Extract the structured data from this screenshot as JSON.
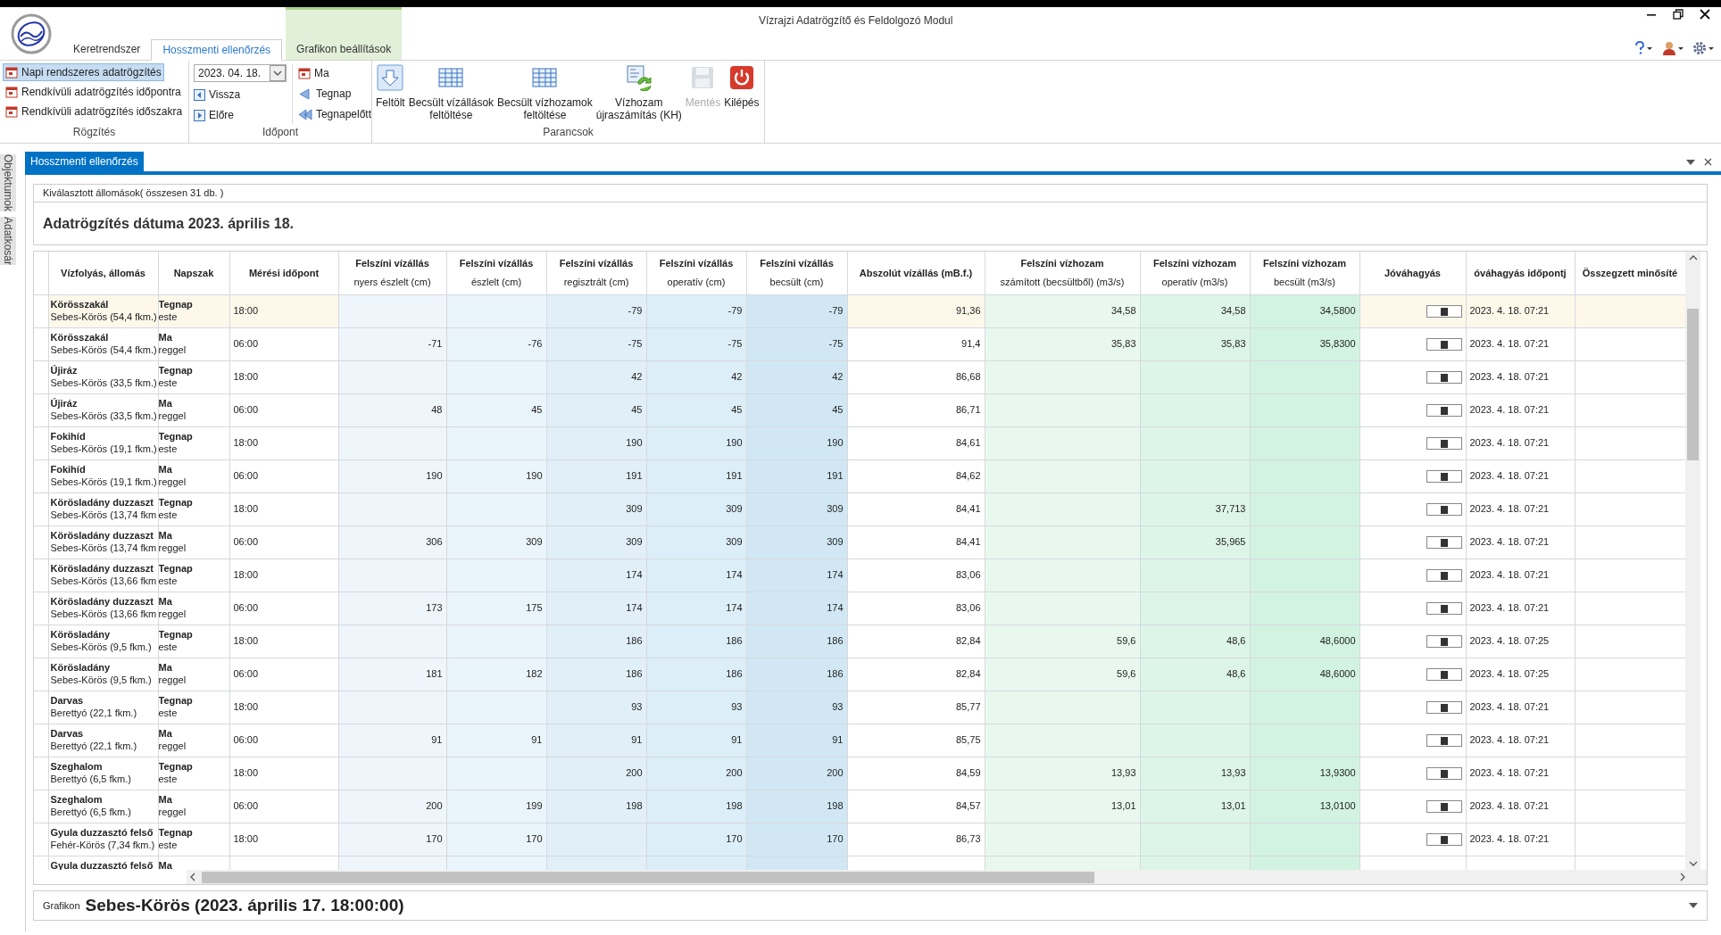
{
  "window": {
    "title": "Vízrajzi Adatrögzítő és Feldolgozó Modul"
  },
  "ribbon_tabs": [
    {
      "label": "Keretrendszer",
      "selected": false,
      "kind": "normal"
    },
    {
      "label": "Hosszmenti ellenőrzés",
      "selected": true,
      "kind": "normal"
    },
    {
      "label": "Grafikon beállítások",
      "selected": false,
      "kind": "contextual"
    }
  ],
  "groups": {
    "rogzites": {
      "caption": "Rögzítés",
      "items": [
        {
          "label": "Napi rendszeres adatrögzítés",
          "selected": true
        },
        {
          "label": "Rendkívüli adatrögzítés időpontra",
          "selected": false
        },
        {
          "label": "Rendkívüli adatrögzítés időszakra",
          "selected": false
        }
      ]
    },
    "idopont": {
      "caption": "Időpont",
      "date": "2023. 04. 18.",
      "steps": [
        "Vissza",
        "Előre"
      ],
      "days": [
        "Ma",
        "Tegnap",
        "Tegnapelőtt"
      ]
    },
    "parancsok": {
      "caption": "Parancsok",
      "buttons": [
        {
          "lines": [
            "Feltölt"
          ],
          "disabled": false
        },
        {
          "lines": [
            "Becsült vízállások",
            "feltöltése"
          ],
          "disabled": false
        },
        {
          "lines": [
            "Becsült vízhozamok",
            "feltöltése"
          ],
          "disabled": false
        },
        {
          "lines": [
            "Vízhozam",
            "újraszámítás (KH)"
          ],
          "disabled": false
        },
        {
          "lines": [
            "Mentés"
          ],
          "disabled": true
        },
        {
          "lines": [
            "Kilépés"
          ],
          "disabled": false
        }
      ]
    }
  },
  "side_tabs": [
    "Objektumok",
    "Adatkosár"
  ],
  "document_tab": {
    "label": "Hosszmenti ellenőrzés",
    "selected": true
  },
  "selection_info": "Kiválasztott állomások( összesen 31 db. )",
  "heading": "Adatrögzítés dátuma 2023. április 18.",
  "table": {
    "columns": [
      {
        "title": "Vízfolyás, állomás"
      },
      {
        "title": "Napszak"
      },
      {
        "title": "Mérési időpont"
      },
      {
        "title": "Felszíni vízállás",
        "subtitle": "nyers észlelt (cm)"
      },
      {
        "title": "Felszíni vízállás",
        "subtitle": "észlelt (cm)"
      },
      {
        "title": "Felszíni vízállás",
        "subtitle": "regisztrált (cm)"
      },
      {
        "title": "Felszíni vízállás",
        "subtitle": "operatív (cm)"
      },
      {
        "title": "Felszíni vízállás",
        "subtitle": "becsült (cm)"
      },
      {
        "title": "Abszolút vízállás (mB.f.)"
      },
      {
        "title": "Felszíni vízhozam",
        "subtitle": "számított (becsültből) (m3/s)"
      },
      {
        "title": "Felszíni vízhozam",
        "subtitle": "operatív (m3/s)"
      },
      {
        "title": "Felszíni vízhozam",
        "subtitle": "becsült (m3/s)"
      },
      {
        "title": "Jóváhagyás"
      },
      {
        "title": "óváhagyás időpontj"
      },
      {
        "title": "Összegzett minősíté"
      }
    ],
    "rows": [
      {
        "station": "Körösszakál",
        "river": "Sebes-Körös (54,4 fkm.)",
        "period": "Tegnap",
        "period_detail": "este",
        "time": "18:00",
        "values": {
          "regisztralt": "-79",
          "operativ": "-79",
          "becsult": "-79",
          "abszolut": "91,36",
          "q_szamitott": "34,58",
          "q_operativ": "34,58",
          "q_becsult": "34,5800"
        },
        "approved": true,
        "approval_time": "2023. 4. 18. 07:21",
        "selected": true
      },
      {
        "station": "Körösszakál",
        "river": "Sebes-Körös (54,4 fkm.)",
        "period": "Ma",
        "period_detail": "reggel",
        "time": "06:00",
        "values": {
          "nyers": "-71",
          "eszlelt": "-76",
          "regisztralt": "-75",
          "operativ": "-75",
          "becsult": "-75",
          "abszolut": "91,4",
          "q_szamitott": "35,83",
          "q_operativ": "35,83",
          "q_becsult": "35,8300"
        },
        "approved": true,
        "approval_time": "2023. 4. 18. 07:21",
        "selected": false
      },
      {
        "station": "Újiráz",
        "river": "Sebes-Körös (33,5 fkm.)",
        "period": "Tegnap",
        "period_detail": "este",
        "time": "18:00",
        "values": {
          "regisztralt": "42",
          "operativ": "42",
          "becsult": "42",
          "abszolut": "86,68"
        },
        "approved": true,
        "approval_time": "2023. 4. 18. 07:21",
        "selected": false
      },
      {
        "station": "Újiráz",
        "river": "Sebes-Körös (33,5 fkm.)",
        "period": "Ma",
        "period_detail": "reggel",
        "time": "06:00",
        "values": {
          "nyers": "48",
          "eszlelt": "45",
          "regisztralt": "45",
          "operativ": "45",
          "becsult": "45",
          "abszolut": "86,71"
        },
        "approved": true,
        "approval_time": "2023. 4. 18. 07:21",
        "selected": false
      },
      {
        "station": "Fokihíd",
        "river": "Sebes-Körös (19,1 fkm.)",
        "period": "Tegnap",
        "period_detail": "este",
        "time": "18:00",
        "values": {
          "regisztralt": "190",
          "operativ": "190",
          "becsult": "190",
          "abszolut": "84,61"
        },
        "approved": true,
        "approval_time": "2023. 4. 18. 07:21",
        "selected": false
      },
      {
        "station": "Fokihíd",
        "river": "Sebes-Körös (19,1 fkm.)",
        "period": "Ma",
        "period_detail": "reggel",
        "time": "06:00",
        "values": {
          "nyers": "190",
          "eszlelt": "190",
          "regisztralt": "191",
          "operativ": "191",
          "becsult": "191",
          "abszolut": "84,62"
        },
        "approved": true,
        "approval_time": "2023. 4. 18. 07:21",
        "selected": false
      },
      {
        "station": "Körösladány duzzaszt",
        "river": "Sebes-Körös (13,74 fkm",
        "period": "Tegnap",
        "period_detail": "este",
        "time": "18:00",
        "values": {
          "regisztralt": "309",
          "operativ": "309",
          "becsult": "309",
          "abszolut": "84,41",
          "q_operativ": "37,713"
        },
        "approved": true,
        "approval_time": "2023. 4. 18. 07:21",
        "selected": false
      },
      {
        "station": "Körösladány duzzaszt",
        "river": "Sebes-Körös (13,74 fkm",
        "period": "Ma",
        "period_detail": "reggel",
        "time": "06:00",
        "values": {
          "nyers": "306",
          "eszlelt": "309",
          "regisztralt": "309",
          "operativ": "309",
          "becsult": "309",
          "abszolut": "84,41",
          "q_operativ": "35,965"
        },
        "approved": true,
        "approval_time": "2023. 4. 18. 07:21",
        "selected": false
      },
      {
        "station": "Körösladány duzzaszt",
        "river": "Sebes-Körös (13,66 fkm",
        "period": "Tegnap",
        "period_detail": "este",
        "time": "18:00",
        "values": {
          "regisztralt": "174",
          "operativ": "174",
          "becsult": "174",
          "abszolut": "83,06"
        },
        "approved": true,
        "approval_time": "2023. 4. 18. 07:21",
        "selected": false
      },
      {
        "station": "Körösladány duzzaszt",
        "river": "Sebes-Körös (13,66 fkm",
        "period": "Ma",
        "period_detail": "reggel",
        "time": "06:00",
        "values": {
          "nyers": "173",
          "eszlelt": "175",
          "regisztralt": "174",
          "operativ": "174",
          "becsult": "174",
          "abszolut": "83,06"
        },
        "approved": true,
        "approval_time": "2023. 4. 18. 07:21",
        "selected": false
      },
      {
        "station": "Körösladány",
        "river": "Sebes-Körös (9,5 fkm.)",
        "period": "Tegnap",
        "period_detail": "este",
        "time": "18:00",
        "values": {
          "regisztralt": "186",
          "operativ": "186",
          "becsult": "186",
          "abszolut": "82,84",
          "q_szamitott": "59,6",
          "q_operativ": "48,6",
          "q_becsult": "48,6000"
        },
        "approved": true,
        "approval_time": "2023. 4. 18. 07:25",
        "selected": false
      },
      {
        "station": "Körösladány",
        "river": "Sebes-Körös (9,5 fkm.)",
        "period": "Ma",
        "period_detail": "reggel",
        "time": "06:00",
        "values": {
          "nyers": "181",
          "eszlelt": "182",
          "regisztralt": "186",
          "operativ": "186",
          "becsult": "186",
          "abszolut": "82,84",
          "q_szamitott": "59,6",
          "q_operativ": "48,6",
          "q_becsult": "48,6000"
        },
        "approved": true,
        "approval_time": "2023. 4. 18. 07:25",
        "selected": false
      },
      {
        "station": "Darvas",
        "river": "Berettyó (22,1 fkm.)",
        "period": "Tegnap",
        "period_detail": "este",
        "time": "18:00",
        "values": {
          "regisztralt": "93",
          "operativ": "93",
          "becsult": "93",
          "abszolut": "85,77"
        },
        "approved": true,
        "approval_time": "2023. 4. 18. 07:21",
        "selected": false
      },
      {
        "station": "Darvas",
        "river": "Berettyó (22,1 fkm.)",
        "period": "Ma",
        "period_detail": "reggel",
        "time": "06:00",
        "values": {
          "nyers": "91",
          "eszlelt": "91",
          "regisztralt": "91",
          "operativ": "91",
          "becsult": "91",
          "abszolut": "85,75"
        },
        "approved": true,
        "approval_time": "2023. 4. 18. 07:21",
        "selected": false
      },
      {
        "station": "Szeghalom",
        "river": "Berettyó (6,5 fkm.)",
        "period": "Tegnap",
        "period_detail": "este",
        "time": "18:00",
        "values": {
          "regisztralt": "200",
          "operativ": "200",
          "becsult": "200",
          "abszolut": "84,59",
          "q_szamitott": "13,93",
          "q_operativ": "13,93",
          "q_becsult": "13,9300"
        },
        "approved": true,
        "approval_time": "2023. 4. 18. 07:21",
        "selected": false
      },
      {
        "station": "Szeghalom",
        "river": "Berettyó (6,5 fkm.)",
        "period": "Ma",
        "period_detail": "reggel",
        "time": "06:00",
        "values": {
          "nyers": "200",
          "eszlelt": "199",
          "regisztralt": "198",
          "operativ": "198",
          "becsult": "198",
          "abszolut": "84,57",
          "q_szamitott": "13,01",
          "q_operativ": "13,01",
          "q_becsult": "13,0100"
        },
        "approved": true,
        "approval_time": "2023. 4. 18. 07:21",
        "selected": false
      },
      {
        "station": "Gyula duzzasztó felső",
        "river": "Fehér-Körös (7,34 fkm.)",
        "period": "Tegnap",
        "period_detail": "este",
        "time": "18:00",
        "values": {
          "nyers": "170",
          "eszlelt": "170",
          "operativ": "170",
          "becsult": "170",
          "abszolut": "86,73"
        },
        "approved": true,
        "approval_time": "2023. 4. 18. 07:21",
        "selected": false
      },
      {
        "station": "Gyula duzzasztó felső",
        "period": "Ma",
        "selected": false
      }
    ]
  },
  "graph_panel": {
    "label": "Grafikon",
    "title": "Sebes-Körös (2023. április 17. 18:00:00)"
  }
}
